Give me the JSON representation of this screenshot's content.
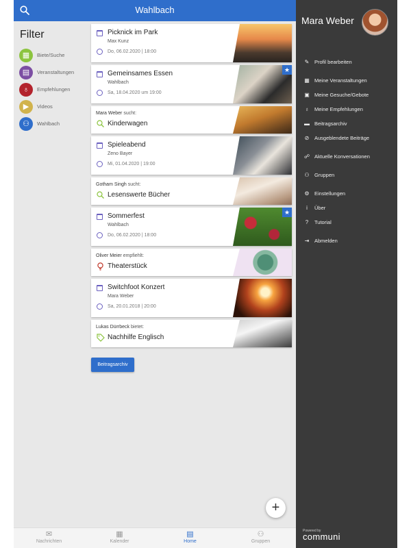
{
  "header": {
    "title": "Wahlbach"
  },
  "filter": {
    "title": "Filter",
    "items": [
      {
        "label": "Biete/Suche",
        "color": "#8cc43f",
        "icon": "gift-icon"
      },
      {
        "label": "Veranstaltungen",
        "color": "#7c4ea3",
        "icon": "calendar-icon"
      },
      {
        "label": "Empfehlungen",
        "color": "#b3232c",
        "icon": "lightbulb-icon"
      },
      {
        "label": "Videos",
        "color": "#d1b34c",
        "icon": "play-icon"
      },
      {
        "label": "Wahlbach",
        "color": "#2f6ecb",
        "icon": "group-icon"
      }
    ]
  },
  "feed": [
    {
      "kind": "event",
      "title": "Picknick im Park",
      "sub": "Max Kunz",
      "date": "Do, 06.02.2020 | 18:00"
    },
    {
      "kind": "event",
      "title": "Gemeinsames Essen",
      "sub": "Wahlbach",
      "date": "Sa, 18.04.2020 um 19:00",
      "starred": true
    },
    {
      "kind": "post",
      "who": "Mara Weber",
      "verb": "sucht:",
      "title": "Kinderwagen",
      "icon": "search-icon"
    },
    {
      "kind": "event",
      "title": "Spieleabend",
      "sub": "Zeno Bayer",
      "date": "Mi, 01.04.2020 | 19:00"
    },
    {
      "kind": "post",
      "who": "Gotham Singh",
      "verb": "sucht:",
      "title": "Lesenswerte Bücher",
      "icon": "search-icon"
    },
    {
      "kind": "event",
      "title": "Sommerfest",
      "sub": "Wahlbach",
      "date": "Do, 06.02.2020 | 18:00",
      "starred": true
    },
    {
      "kind": "post",
      "who": "Oliver Meier",
      "verb": "empfiehlt:",
      "title": "Theaterstück",
      "icon": "lightbulb-icon"
    },
    {
      "kind": "event",
      "title": "Switchfoot Konzert",
      "sub": "Mara Weber",
      "date": "Sa, 20.01.2018 | 20:00"
    },
    {
      "kind": "post",
      "who": "Lukas Dürrbeck",
      "verb": "bietet:",
      "title": "Nachhilfe Englisch",
      "icon": "tag-icon"
    }
  ],
  "archive_button": "Beitragsarchiv",
  "fab": "+",
  "bottom_nav": [
    {
      "label": "Nachrichten",
      "icon": "mail-icon"
    },
    {
      "label": "Kalender",
      "icon": "calendar-icon"
    },
    {
      "label": "Home",
      "icon": "home-icon",
      "active": true
    },
    {
      "label": "Gruppen",
      "icon": "groups-icon"
    }
  ],
  "drawer": {
    "user_name": "Mara Weber",
    "menu": [
      {
        "label": "Profil bearbeiten",
        "icon": "edit-icon"
      },
      {
        "label": "Meine Veranstaltungen",
        "icon": "calendar-icon"
      },
      {
        "label": "Meine Gesuche/Gebote",
        "icon": "gift-icon"
      },
      {
        "label": "Meine Empfehlungen",
        "icon": "lightbulb-icon"
      },
      {
        "label": "Beitragsarchiv",
        "icon": "archive-icon"
      },
      {
        "label": "Ausgeblendete Beiträge",
        "icon": "eye-off-icon"
      },
      {
        "label": "Aktuelle Konversationen",
        "icon": "chat-icon"
      },
      {
        "label": "Gruppen",
        "icon": "groups-icon"
      },
      {
        "label": "Einstellungen",
        "icon": "gear-icon"
      },
      {
        "label": "Über",
        "icon": "info-icon"
      },
      {
        "label": "Tutorial",
        "icon": "help-icon"
      },
      {
        "label": "Abmelden",
        "icon": "logout-icon"
      }
    ],
    "powered_by": "Powered by",
    "brand": "communi"
  }
}
